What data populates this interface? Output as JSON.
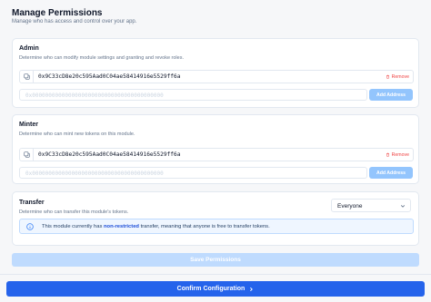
{
  "header": {
    "title": "Manage Permissions",
    "subtitle": "Manage who has access and control over your app."
  },
  "roles": [
    {
      "title": "Admin",
      "description": "Determine who can modify module settings and granting and revoke roles.",
      "address": "0x9C33cD8e20c595Aad0C04ae58414916e5529ff6a",
      "remove_label": "Remove",
      "input_placeholder": "0x0000000000000000000000000000000000000000",
      "add_label": "Add Address"
    },
    {
      "title": "Minter",
      "description": "Determine who can mint new tokens on this module.",
      "address": "0x9C33cD8e20c595Aad0C04ae58414916e5529ff6a",
      "remove_label": "Remove",
      "input_placeholder": "0x0000000000000000000000000000000000000000",
      "add_label": "Add Address"
    }
  ],
  "transfer": {
    "title": "Transfer",
    "description": "Determine who can transfer this module's tokens.",
    "select_value": "Everyone",
    "info_prefix": "This module currently has ",
    "info_bold": "non-restricted",
    "info_suffix": " transfer, meaning that anyone is free to transfer tokens."
  },
  "actions": {
    "save_label": "Save Permissions",
    "confirm_label": "Confirm Configuration"
  },
  "colors": {
    "accent": "#2563eb",
    "danger": "#ef4444",
    "disabled_accent": "#93c5fd"
  }
}
